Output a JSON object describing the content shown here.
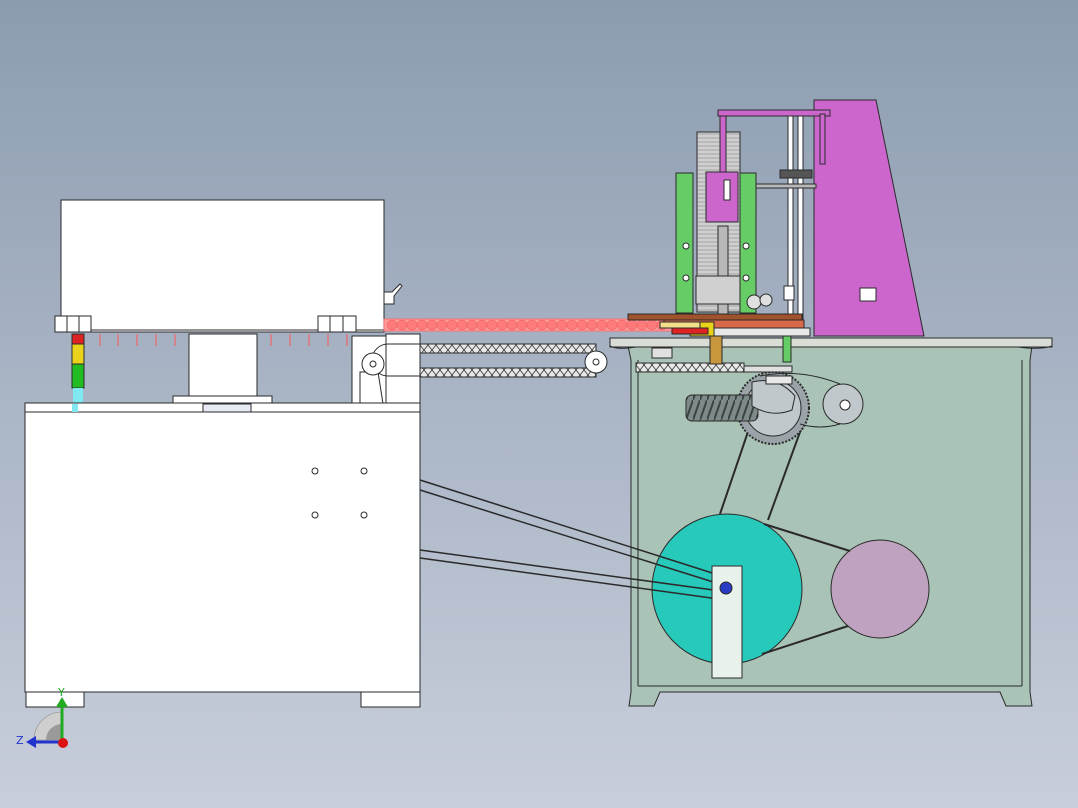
{
  "viewport": {
    "background_top": "#8c9cb0",
    "background_bottom": "#c8cedb"
  },
  "colors": {
    "line": "#2a2a2a",
    "machine_white": "#ffffff",
    "cabinet_green": "#a9c4b6",
    "cabinet_top": "#d9ddd6",
    "drum_teal": "#27c9bb",
    "motor_pink": "#bfa2bf",
    "frame_magenta": "#cc66cc",
    "guide_green": "#66cc66",
    "column_gray": "#b8b8b8",
    "conveyor_red": "#ff7b7b",
    "conveyor_brown": "#a0522d",
    "pulley_gray": "#c0c8cc",
    "gear_gray": "#9aa4a8",
    "worm_gray": "#7d8a88",
    "belt_white": "#f2f2ec",
    "indicator_yellow": "#e8d21a",
    "indicator_green": "#22bb22",
    "indicator_red": "#cc2222",
    "indicator_cyan": "#7fe8f0",
    "shaft_tan": "#c8963c",
    "axis_y": "#22aa22",
    "axis_z": "#2233cc",
    "axis_origin": "#dd1111"
  },
  "triad": {
    "y_label": "Y",
    "z_label": "Z"
  }
}
